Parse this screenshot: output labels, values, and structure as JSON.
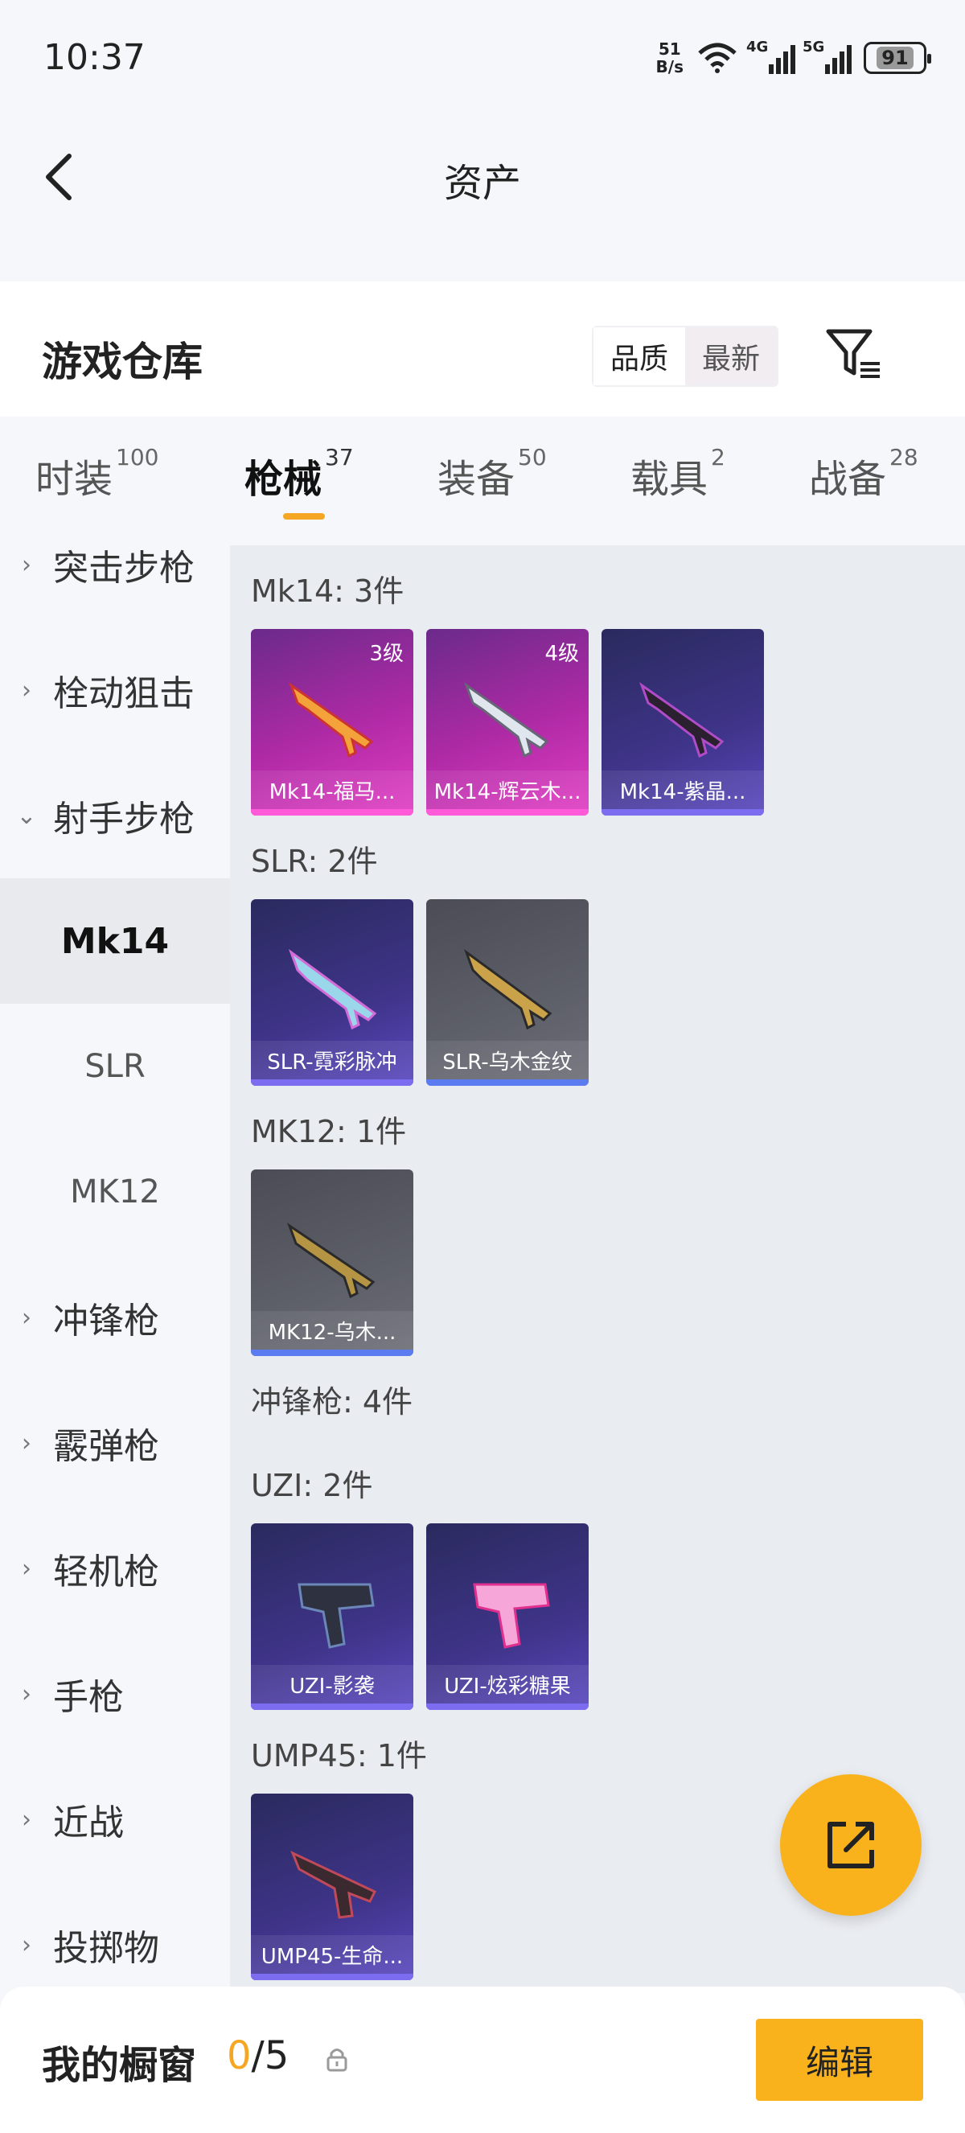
{
  "status_bar": {
    "time": "10:37",
    "net_speed_value": "51",
    "net_speed_unit": "B/s",
    "signal1_label": "4G",
    "signal2_label": "5G",
    "battery": "91"
  },
  "nav": {
    "title": "资产"
  },
  "header": {
    "title": "游戏仓库",
    "sort_options": [
      "品质",
      "最新"
    ],
    "sort_selected": "品质"
  },
  "tabs": [
    {
      "label": "时装",
      "count": "100"
    },
    {
      "label": "枪械",
      "count": "37",
      "active": true
    },
    {
      "label": "装备",
      "count": "50"
    },
    {
      "label": "载具",
      "count": "2"
    },
    {
      "label": "战备",
      "count": "28"
    }
  ],
  "sidebar": {
    "items": [
      {
        "label": "突击步枪",
        "expanded": false
      },
      {
        "label": "栓动狙击",
        "expanded": false
      },
      {
        "label": "射手步枪",
        "expanded": true
      },
      {
        "label": "Mk14",
        "sub": true,
        "active": true
      },
      {
        "label": "SLR",
        "sub": true
      },
      {
        "label": "MK12",
        "sub": true
      },
      {
        "label": "冲锋枪",
        "expanded": false
      },
      {
        "label": "霰弹枪",
        "expanded": false
      },
      {
        "label": "轻机枪",
        "expanded": false
      },
      {
        "label": "手枪",
        "expanded": false
      },
      {
        "label": "近战",
        "expanded": false
      },
      {
        "label": "投掷物",
        "expanded": false
      }
    ]
  },
  "content": {
    "groups": [
      {
        "label": "Mk14: 3件",
        "items": [
          {
            "name": "Mk14-福马...",
            "level": "3级",
            "rarity": "pink"
          },
          {
            "name": "Mk14-辉云木...",
            "level": "4级",
            "rarity": "pink"
          },
          {
            "name": "Mk14-紫晶...",
            "level": "",
            "rarity": "purple"
          }
        ]
      },
      {
        "label": "SLR: 2件",
        "items": [
          {
            "name": "SLR-霓彩脉冲",
            "level": "",
            "rarity": "purple"
          },
          {
            "name": "SLR-乌木金纹",
            "level": "",
            "rarity": "gray"
          }
        ]
      },
      {
        "label": "MK12: 1件",
        "items": [
          {
            "name": "MK12-乌木...",
            "level": "",
            "rarity": "gray"
          }
        ]
      },
      {
        "label": "冲锋枪: 4件",
        "items": []
      },
      {
        "label": "UZI: 2件",
        "items": [
          {
            "name": "UZI-影袭",
            "level": "",
            "rarity": "purple"
          },
          {
            "name": "UZI-炫彩糖果",
            "level": "",
            "rarity": "purple"
          }
        ]
      },
      {
        "label": "UMP45: 1件",
        "items": [
          {
            "name": "UMP45-生命...",
            "level": "",
            "rarity": "purple"
          }
        ]
      }
    ]
  },
  "bottom": {
    "showcase_label": "我的橱窗",
    "showcase_current": "0",
    "showcase_total": "/5",
    "edit_label": "编辑"
  },
  "colors": {
    "accent": "#f9b21b",
    "tab_underline": "#f5a623",
    "rare_pink": "#e23fc4",
    "rare_purple": "#5a48c0",
    "rare_gray": "#5d5f69"
  }
}
